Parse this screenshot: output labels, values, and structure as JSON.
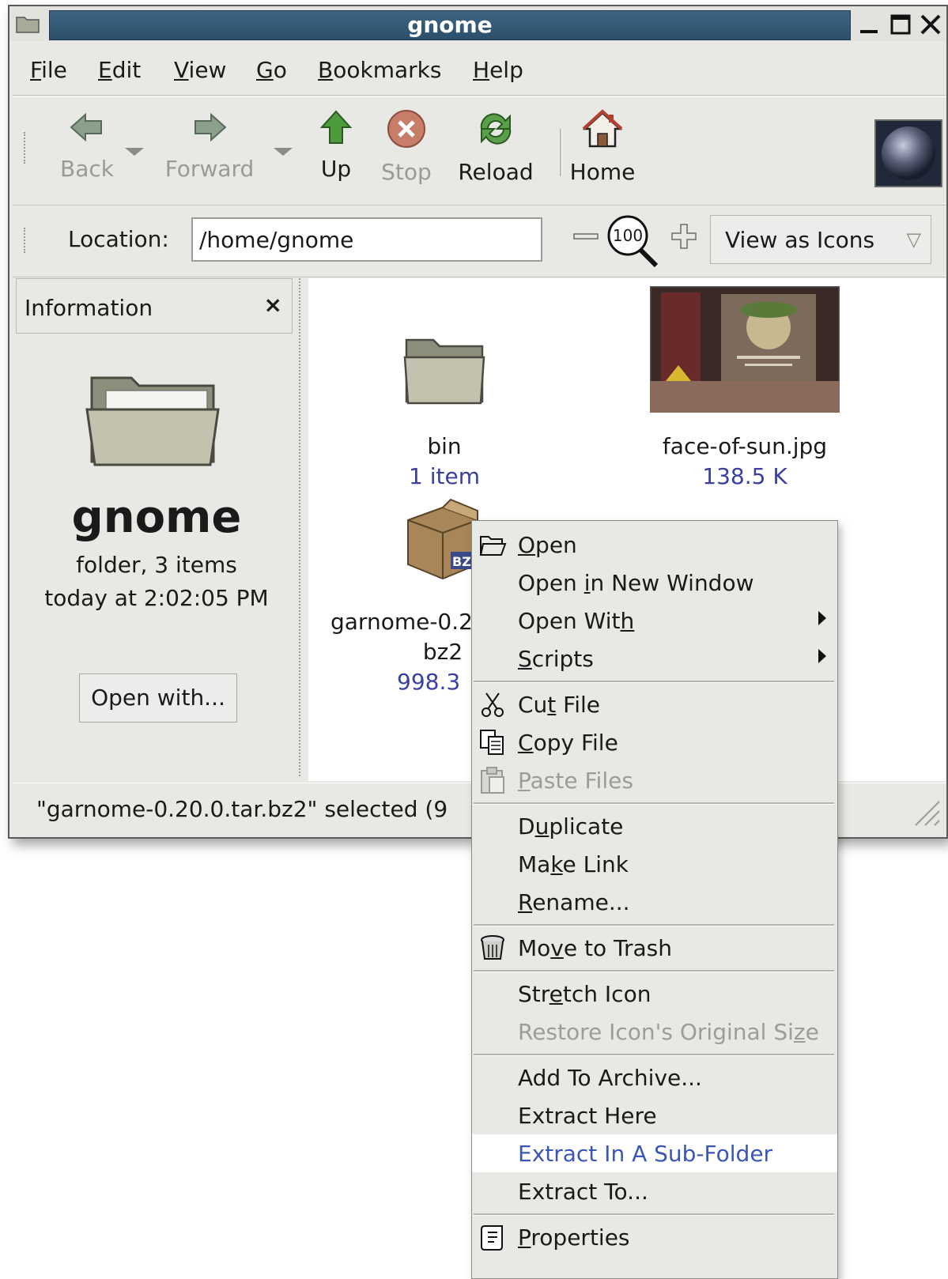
{
  "window": {
    "title": "gnome"
  },
  "menubar": [
    {
      "pre": "",
      "u": "F",
      "post": "ile"
    },
    {
      "pre": "",
      "u": "E",
      "post": "dit"
    },
    {
      "pre": "",
      "u": "V",
      "post": "iew"
    },
    {
      "pre": "",
      "u": "G",
      "post": "o"
    },
    {
      "pre": "",
      "u": "B",
      "post": "ookmarks"
    },
    {
      "pre": "",
      "u": "H",
      "post": "elp"
    }
  ],
  "toolbar": {
    "back": "Back",
    "forward": "Forward",
    "up": "Up",
    "stop": "Stop",
    "reload": "Reload",
    "home": "Home"
  },
  "location": {
    "label": "Location:",
    "value": "/home/gnome",
    "zoom": "100",
    "view_mode": "View as Icons"
  },
  "sidepane": {
    "header": "Information",
    "close": "×",
    "name": "gnome",
    "kind": "folder, 3 items",
    "modified": "today at 2:02:05 PM",
    "open_with": "Open with..."
  },
  "files": [
    {
      "name": "bin",
      "info": "1 item"
    },
    {
      "name": "face-of-sun.jpg",
      "info": "138.5 K"
    },
    {
      "name_line1": "garnome-0.2",
      "name_line2": "bz2",
      "info": "998.3"
    }
  ],
  "statusbar": {
    "text": "\"garnome-0.20.0.tar.bz2\" selected (9"
  },
  "context_menu": {
    "open": {
      "pre": "",
      "u": "O",
      "post": "pen"
    },
    "open_new_window": {
      "pre": "Open ",
      "u": "i",
      "post": "n New Window"
    },
    "open_with": {
      "pre": "Open Wit",
      "u": "h",
      "post": ""
    },
    "scripts": {
      "pre": "",
      "u": "S",
      "post": "cripts"
    },
    "cut_file": {
      "pre": "Cu",
      "u": "t",
      "post": " File"
    },
    "copy_file": {
      "pre": "",
      "u": "C",
      "post": "opy File"
    },
    "paste_files": {
      "pre": "",
      "u": "P",
      "post": "aste Files"
    },
    "duplicate": {
      "pre": "D",
      "u": "u",
      "post": "plicate"
    },
    "make_link": {
      "pre": "Ma",
      "u": "k",
      "post": "e Link"
    },
    "rename": {
      "pre": "",
      "u": "R",
      "post": "ename..."
    },
    "move_to_trash": {
      "pre": "Mo",
      "u": "v",
      "post": "e to Trash"
    },
    "stretch_icon": {
      "pre": "Str",
      "u": "e",
      "post": "tch Icon"
    },
    "restore_icon": {
      "pre": "Restore Icon's Original Si",
      "u": "z",
      "post": "e"
    },
    "add_to_archive": "Add To Archive...",
    "extract_here": "Extract Here",
    "extract_subfolder": "Extract In A Sub-Folder",
    "extract_to": "Extract To...",
    "properties": {
      "pre": "",
      "u": "P",
      "post": "roperties"
    }
  },
  "colors": {
    "title_bar": "#2c4f6a",
    "window_bg": "#e8e8e4",
    "link_blue": "#3a3fa0",
    "highlight_text": "#3a57b8"
  }
}
